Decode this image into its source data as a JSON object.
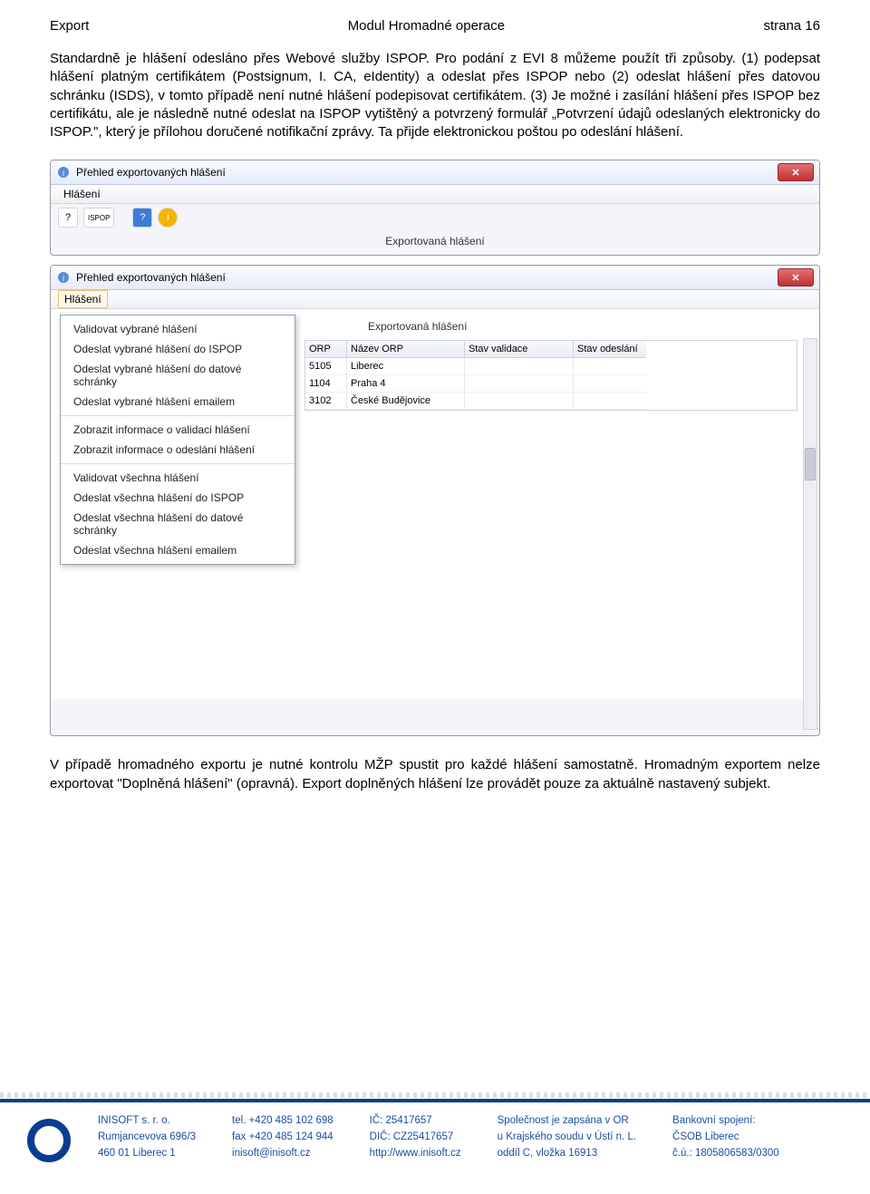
{
  "header": {
    "left": "Export",
    "center": "Modul Hromadné operace",
    "right": "strana 16"
  },
  "body": {
    "p1": "Standardně je hlášení odesláno přes Webové služby ISPOP. Pro podání z EVI 8 můžeme použít tři způsoby. (1) podepsat hlášení platným certifikátem (Postsignum, I. CA, eIdentity) a odeslat přes ISPOP nebo (2) odeslat hlášení přes datovou schránku (ISDS), v tomto případě není nutné hlášení podepisovat certifikátem. (3) Je možné i zasílání hlášení přes ISPOP bez certifikátu, ale je následně nutné odeslat na ISPOP vytištěný a potvrzený formulář „Potvrzení údajů odeslaných elektronicky do ISPOP.\", který je přílohou doručené notifikační zprávy. Ta přijde elektronickou poštou po odeslání hlášení.",
    "p2": "V případě hromadného exportu je nutné kontrolu MŽP spustit pro každé hlášení samostatně. Hromadným exportem nelze exportovat \"Doplněná hlášení\" (opravná). Export doplněných hlášení lze provádět pouze za aktuálně nastavený subjekt."
  },
  "window1": {
    "title": "Přehled exportovaných hlášení",
    "menu": "Hlášení",
    "subtitle": "Exportovaná hlášení",
    "tool_icons": [
      "?",
      "ISPOP",
      "?",
      "i"
    ]
  },
  "window2": {
    "title": "Přehled exportovaných hlášení",
    "menu": "Hlášení",
    "subtitle": "Exportovaná hlášení",
    "context_items": [
      "Validovat vybrané hlášení",
      "Odeslat vybrané hlášení do ISPOP",
      "Odeslat vybrané hlášení do datové schránky",
      "Odeslat vybrané hlášení emailem",
      "Zobrazit informace o validaci hlášení",
      "Zobrazit informace o odeslání hlášení",
      "Validovat všechna hlášení",
      "Odeslat všechna hlášení do ISPOP",
      "Odeslat všechna hlášení do datové schránky",
      "Odeslat všechna hlášení emailem"
    ],
    "grid": {
      "headers": [
        "ORP",
        "Název ORP",
        "Stav validace",
        "Stav odeslání"
      ],
      "rows": [
        [
          "5105",
          "Liberec",
          "",
          ""
        ],
        [
          "1104",
          "Praha 4",
          "",
          ""
        ],
        [
          "3102",
          "České Budějovice",
          "",
          ""
        ]
      ]
    }
  },
  "footer": {
    "col1": [
      "INISOFT s. r. o.",
      "Rumjancevova 696/3",
      "460 01  Liberec 1"
    ],
    "col2": [
      "tel. +420 485 102 698",
      "fax +420 485 124 944",
      "inisoft@inisoft.cz"
    ],
    "col3": [
      "IČ: 25417657",
      "DIČ: CZ25417657",
      "http://www.inisoft.cz"
    ],
    "col4": [
      "Společnost je zapsána v OR",
      "u Krajského soudu v Ústí n. L.",
      "oddíl C, vložka 16913"
    ],
    "col5": [
      "Bankovní spojení:",
      "ČSOB Liberec",
      "č.ú.: 1805806583/0300"
    ]
  }
}
